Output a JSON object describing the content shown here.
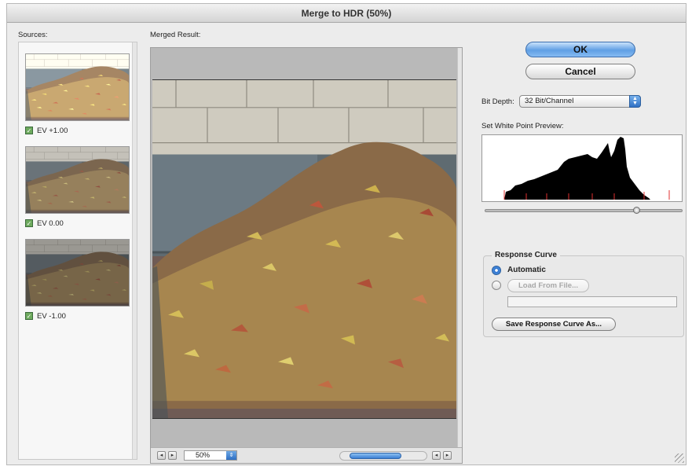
{
  "window": {
    "title": "Merge to HDR (50%)"
  },
  "sources": {
    "label": "Sources:",
    "items": [
      {
        "ev_label": "EV +1.00",
        "checked": true
      },
      {
        "ev_label": "EV 0.00",
        "checked": true
      },
      {
        "ev_label": "EV -1.00",
        "checked": true
      }
    ]
  },
  "preview": {
    "label": "Merged Result:",
    "zoom_value": "50%"
  },
  "buttons": {
    "ok": "OK",
    "cancel": "Cancel"
  },
  "bit_depth": {
    "label": "Bit Depth:",
    "value": "32 Bit/Channel"
  },
  "white_point": {
    "label": "Set White Point Preview:",
    "slider_fraction": 0.78
  },
  "response_curve": {
    "group_label": "Response Curve",
    "automatic_label": "Automatic",
    "automatic_selected": true,
    "load_button": "Load From File...",
    "path_value": "",
    "save_button": "Save Response Curve As..."
  },
  "colors": {
    "accent_blue": "#3b7fd4",
    "checkbox_green": "#6eaa5e",
    "histogram_fill": "#000000",
    "clip_marker": "#e03030"
  },
  "icons": {
    "checkbox": "check-icon",
    "stepper": "stepper-arrows-icon",
    "scroll_left": "arrow-left-icon",
    "scroll_right": "arrow-right-icon"
  }
}
